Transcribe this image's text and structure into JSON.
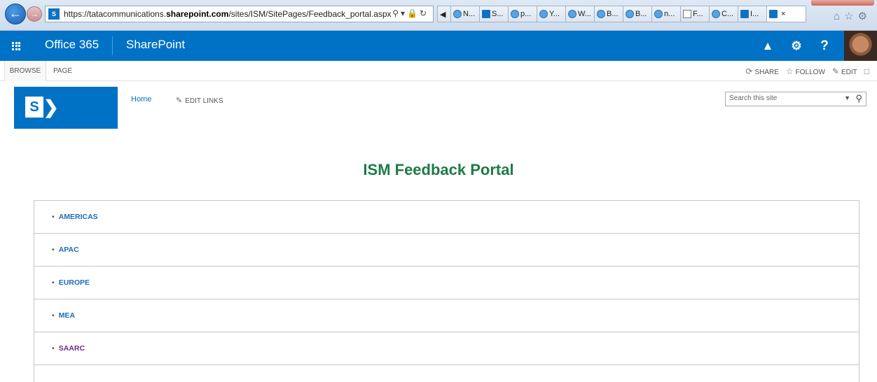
{
  "browser": {
    "url_prefix": "https://tatacommunications.",
    "url_domain": "sharepoint.com",
    "url_path": "/sites/ISM/SitePages/Feedback_portal.aspx",
    "tabs": [
      {
        "label": "N..."
      },
      {
        "label": "S..."
      },
      {
        "label": "p..."
      },
      {
        "label": "Y..."
      },
      {
        "label": "W..."
      },
      {
        "label": "B..."
      },
      {
        "label": "B..."
      },
      {
        "label": "n..."
      },
      {
        "label": "F..."
      },
      {
        "label": "C..."
      },
      {
        "label": "I..."
      }
    ]
  },
  "suite": {
    "brand": "Office 365",
    "app": "SharePoint",
    "help_label": "?"
  },
  "ribbon": {
    "browse": "BROWSE",
    "page": "PAGE",
    "share": "SHARE",
    "follow": "FOLLOW",
    "edit": "EDIT"
  },
  "site": {
    "logo_letter": "S",
    "home": "Home",
    "edit_links": "EDIT LINKS",
    "search_placeholder": "Search this site"
  },
  "main": {
    "title": "ISM Feedback Portal",
    "regions": [
      {
        "label": "AMERICAS"
      },
      {
        "label": "APAC"
      },
      {
        "label": "EUROPE"
      },
      {
        "label": "MEA"
      },
      {
        "label": "SAARC"
      }
    ]
  },
  "colors": {
    "suite_blue": "#0072c6",
    "title_green": "#1f7a46",
    "link_blue": "#1e6bb8",
    "visited_purple": "#6b2d86"
  }
}
